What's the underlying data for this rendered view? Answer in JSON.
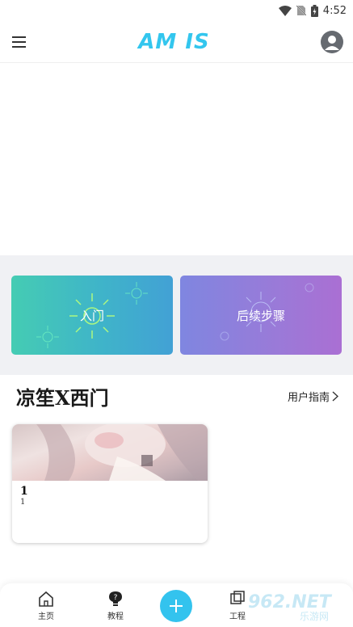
{
  "status": {
    "time": "4:52"
  },
  "header": {
    "logo": "AM IS",
    "menu_icon": "menu-icon",
    "avatar_icon": "account-icon"
  },
  "entries": [
    {
      "label": "入门"
    },
    {
      "label": "后续步骤"
    }
  ],
  "section": {
    "title": "凉笙X西门",
    "guide_label": "用户指南"
  },
  "project": {
    "name": "1",
    "subtitle": "1"
  },
  "nav": {
    "items": [
      {
        "label": "主页"
      },
      {
        "label": "教程"
      },
      {
        "label": "工程"
      }
    ],
    "add_icon": "plus-icon"
  },
  "watermark": {
    "text": "962.NET",
    "subtext": "乐游网"
  },
  "colors": {
    "accent": "#33c3ee",
    "intro_card": "#45ccb3",
    "next_card": "#9a7ad8"
  }
}
